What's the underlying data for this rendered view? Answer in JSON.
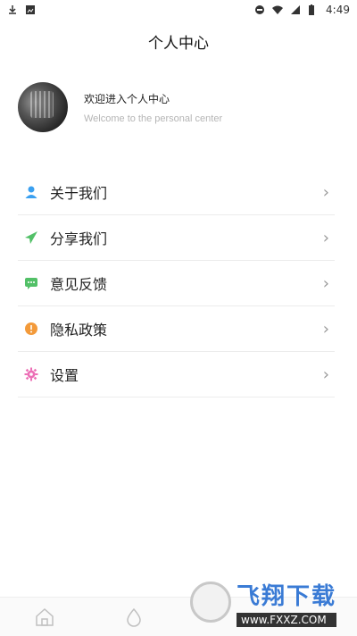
{
  "status_bar": {
    "time": "4:49"
  },
  "header": {
    "title": "个人中心"
  },
  "profile": {
    "title": "欢迎进入个人中心",
    "subtitle": "Welcome to the personal center"
  },
  "menu": {
    "items": [
      {
        "label": "关于我们",
        "icon": "user-icon",
        "color": "#3aa0f0"
      },
      {
        "label": "分享我们",
        "icon": "paper-plane-icon",
        "color": "#52c067"
      },
      {
        "label": "意见反馈",
        "icon": "chat-bubble-icon",
        "color": "#52c067"
      },
      {
        "label": "隐私政策",
        "icon": "info-circle-icon",
        "color": "#f39a3a"
      },
      {
        "label": "设置",
        "icon": "gear-icon",
        "color": "#ec6fb6"
      }
    ],
    "chevron": "›"
  },
  "watermark": {
    "title": "飞翔下载",
    "url": "www.FXXZ.COM"
  }
}
